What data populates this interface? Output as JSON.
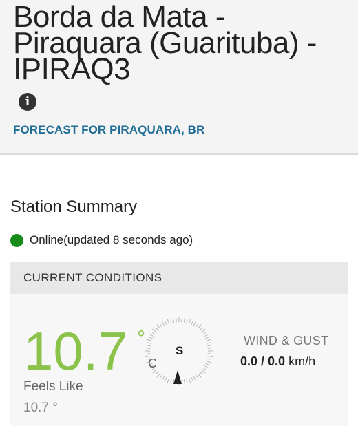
{
  "station": {
    "title": "Borda da Mata - Piraquara (Guarituba) - IPIRAQ3",
    "forecast_link": "FORECAST FOR PIRAQUARA, BR"
  },
  "summary": {
    "title": "Station Summary",
    "status": "Online(updated 8 seconds ago)",
    "status_color": "#178a1a"
  },
  "conditions": {
    "header": "CURRENT CONDITIONS",
    "temperature": "10.7",
    "temp_degree": "°",
    "temp_color": "#8bc34a",
    "feels_like_label": "Feels Like",
    "feels_like_value": "10.7 °",
    "compass_unit": "C",
    "compass_dir": "S",
    "wind_gust_label": "WIND & GUST",
    "wind": "0.0",
    "separator": " / ",
    "gust": "0.0",
    "wind_unit": " km/h"
  }
}
